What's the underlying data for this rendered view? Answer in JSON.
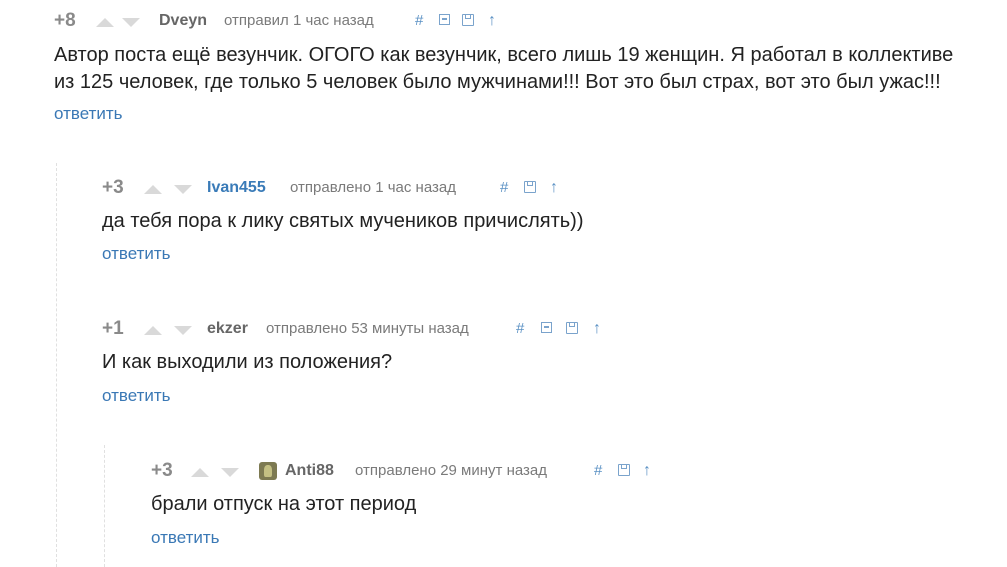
{
  "comments": [
    {
      "rating": "+8",
      "author": "Dveyn",
      "meta": "отправил 1 час назад",
      "hash": "#",
      "lines": [
        "Автор поста ещё везунчик. ОГОГО как везунчик, всего лишь 19 женщин. Я работал в коллективе",
        "из 125 человек, где только 5 человек было мужчинами!!! Вот это был страх, вот это был ужас!!!"
      ],
      "reply": "ответить"
    },
    {
      "rating": "+3",
      "author": "Ivan455",
      "meta": "отправлено 1 час назад",
      "hash": "#",
      "text": "да тебя пора к лику святых мучеников причислять))",
      "reply": "ответить"
    },
    {
      "rating": "+1",
      "author": "ekzer",
      "meta": "отправлено 53 минуты назад",
      "hash": "#",
      "text": "И как выходили из положения?",
      "reply": "ответить"
    },
    {
      "rating": "+3",
      "author": "Anti88",
      "meta": "отправлено 29 минут назад",
      "hash": "#",
      "text": "брали отпуск на этот период",
      "reply": "ответить"
    }
  ],
  "colors": {
    "link": "#3a78b5",
    "author_highlight": "#3a7bb8",
    "vote_arrow": "#d9d9d9",
    "avatar": "#7d7a52"
  },
  "icons": [
    "arrow-up-icon",
    "arrow-down-icon",
    "hash-link-icon",
    "collapse-icon",
    "save-icon",
    "parent-up-icon",
    "avatar-icon"
  ]
}
